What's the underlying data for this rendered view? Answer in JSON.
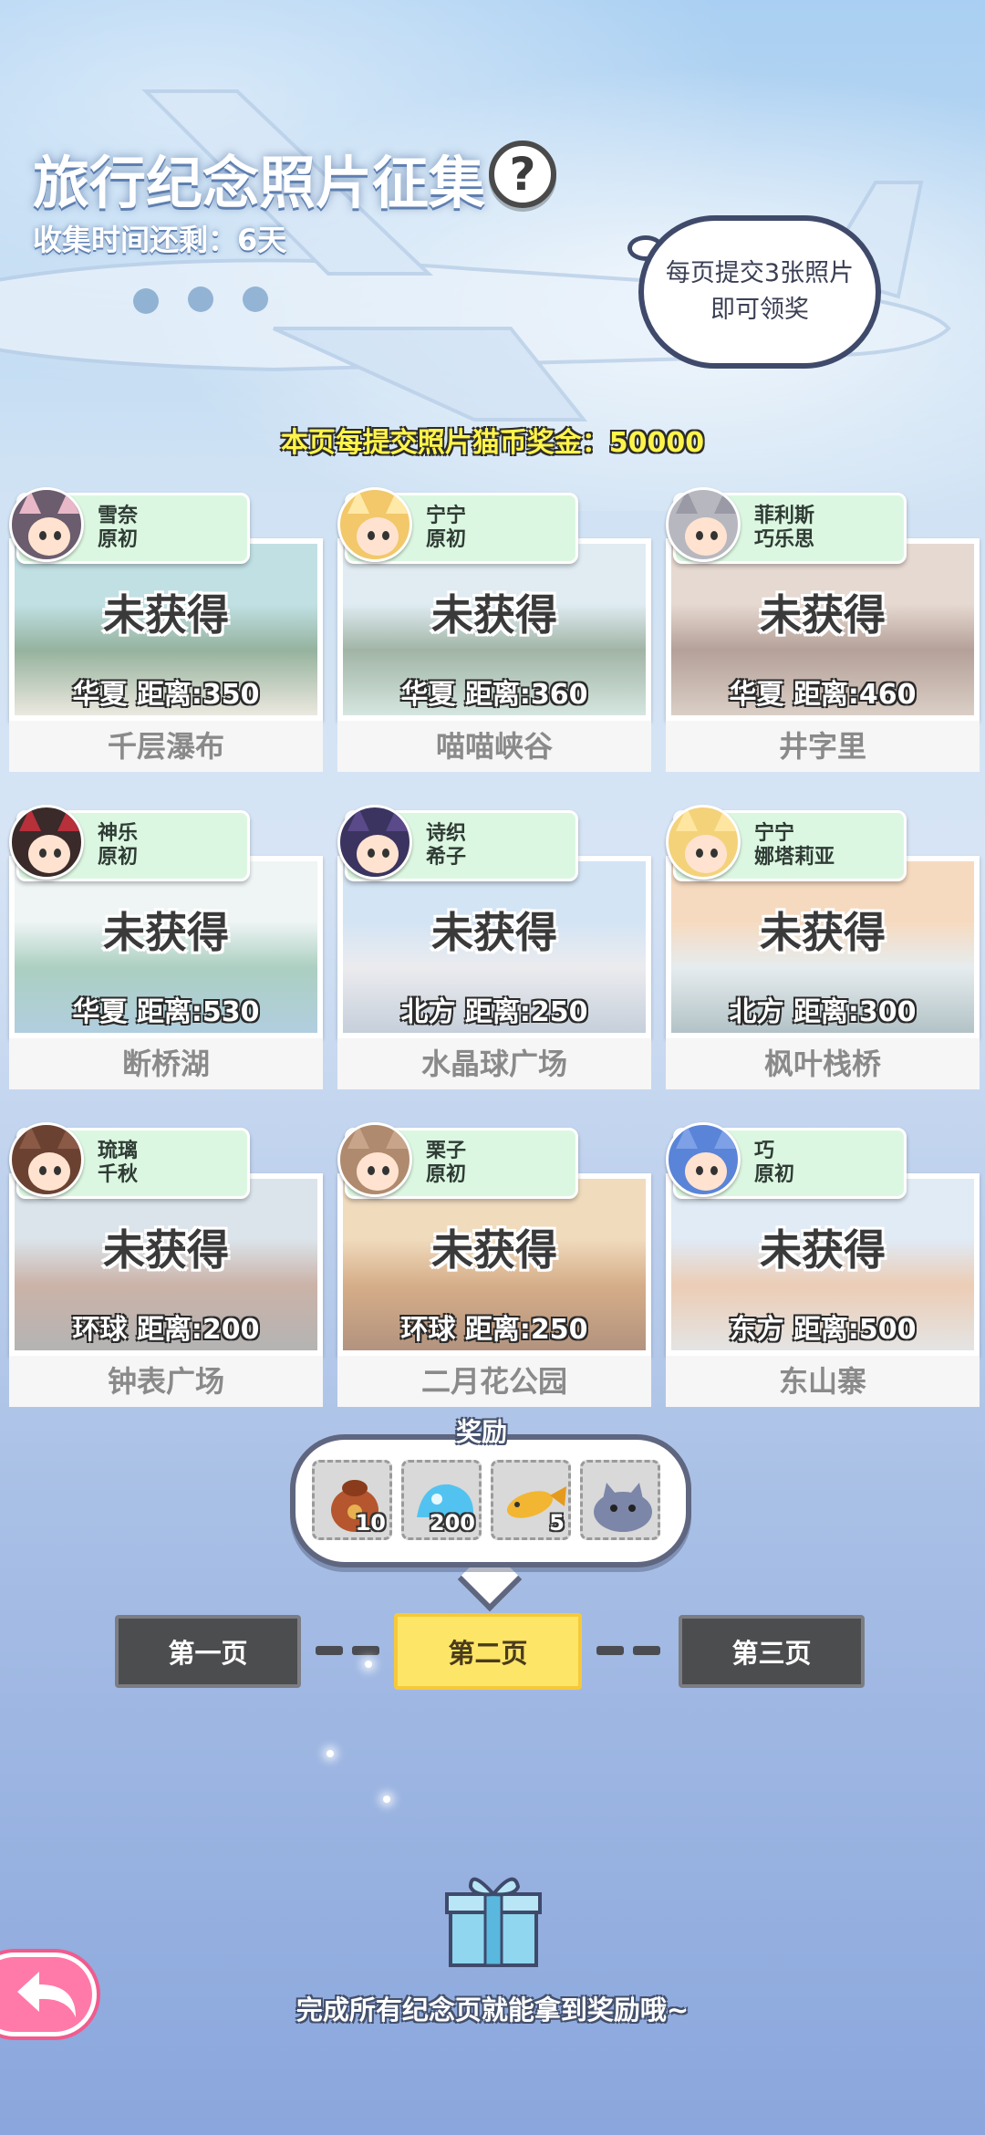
{
  "header": {
    "title": "旅行纪念照片征集",
    "help_icon_label": "?",
    "countdown": "收集时间还剩：6天"
  },
  "hint_bubble": {
    "text_line1": "每页提交3张照片",
    "text_line2": "即可领奖"
  },
  "bonus_text": "本页每提交照片猫币奖金：50000",
  "cards": [
    {
      "char1": "雪奈",
      "char2": "原初",
      "status": "未获得",
      "distance": "华夏  距离:350",
      "place": "千层瀑布",
      "hair": "#6b5c6e",
      "ears": "#e8b8c8",
      "scene": [
        "#9fd0d6",
        "#5d8a6a",
        "#e2dccf"
      ]
    },
    {
      "char1": "宁宁",
      "char2": "原初",
      "status": "未获得",
      "distance": "华夏  距离:360",
      "place": "喵喵峡谷",
      "hair": "#f2c86a",
      "ears": "#ffe9a8",
      "scene": [
        "#cfe2ec",
        "#6f8d76",
        "#bfd9cf"
      ]
    },
    {
      "char1": "菲利斯",
      "char2": "巧乐思",
      "status": "未获得",
      "distance": "华夏  距离:460",
      "place": "井字里",
      "hair": "#b7b7bf",
      "ears": "#9a9aa6",
      "scene": [
        "#d9c5b8",
        "#8d6e62",
        "#c7b5a8"
      ]
    },
    {
      "char1": "神乐",
      "char2": "原初",
      "status": "未获得",
      "distance": "华夏  距离:530",
      "place": "断桥湖",
      "hair": "#3a2a2a",
      "ears": "#b7303a",
      "scene": [
        "#e6f0f0",
        "#7fb6a0",
        "#88b4cf"
      ]
    },
    {
      "char1": "诗织",
      "char2": "希子",
      "status": "未获得",
      "distance": "北方  距离:250",
      "place": "水晶球广场",
      "hair": "#3b3460",
      "ears": "#5a4a8a",
      "scene": [
        "#bcd6ef",
        "#e1e1e6",
        "#a7b6c7"
      ]
    },
    {
      "char1": "宁宁",
      "char2": "娜塔莉亚",
      "status": "未获得",
      "distance": "北方  距离:300",
      "place": "枫叶栈桥",
      "hair": "#f4d27a",
      "ears": "#ffe6a0",
      "scene": [
        "#f2c79e",
        "#d8e2e6",
        "#8aa2a8"
      ]
    },
    {
      "char1": "琉璃",
      "char2": "千秋",
      "status": "未获得",
      "distance": "环球  距离:200",
      "place": "钟表广场",
      "hair": "#6b4232",
      "ears": "#8a5a46",
      "scene": [
        "#c8d6e0",
        "#b08a7a",
        "#8c8c8c"
      ]
    },
    {
      "char1": "栗子",
      "char2": "原初",
      "status": "未获得",
      "distance": "环球  距离:250",
      "place": "二月花公园",
      "hair": "#b08a6e",
      "ears": "#c8a58a",
      "scene": [
        "#e8c89a",
        "#c0824a",
        "#8a5a3a"
      ]
    },
    {
      "char1": "巧",
      "char2": "原初",
      "status": "未获得",
      "distance": "东方  距离:500",
      "place": "东山寨",
      "hair": "#5a84d8",
      "ears": "#7ea0e6",
      "scene": [
        "#cfe0f2",
        "#e2b28e",
        "#d6d6d6"
      ]
    }
  ],
  "rewards": {
    "label": "奖励",
    "items": [
      {
        "icon": "pouch-icon",
        "qty": "10"
      },
      {
        "icon": "blue-slime-icon",
        "qty": "200"
      },
      {
        "icon": "fish-icon",
        "qty": "5"
      },
      {
        "icon": "cat-plush-icon",
        "qty": ""
      }
    ]
  },
  "pages": {
    "page1": "第一页",
    "page2": "第二页",
    "page3": "第三页",
    "active": 2
  },
  "footer": {
    "text": "完成所有纪念页就能拿到奖励哦~"
  },
  "colors": {
    "bonus_yellow": "#fff44a",
    "active_page": "#fde567",
    "tag_green": "#dcf7e1",
    "back_pink": "#ff7aa9"
  }
}
